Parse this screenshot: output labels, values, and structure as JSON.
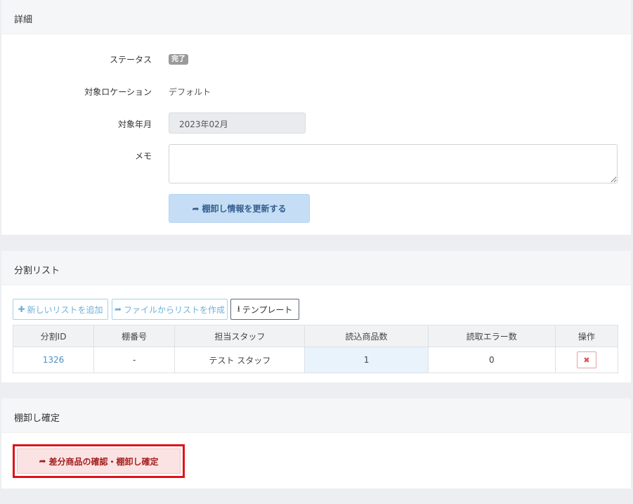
{
  "details": {
    "title": "詳細",
    "status_label": "ステータス",
    "status_value": "完了",
    "location_label": "対象ロケーション",
    "location_value": "デフォルト",
    "month_label": "対象年月",
    "month_value": "2023年02月",
    "memo_label": "メモ",
    "memo_value": "",
    "update_button": "棚卸し情報を更新する"
  },
  "split_list": {
    "title": "分割リスト",
    "add_button": "新しいリストを追加",
    "from_file_button": "ファイルからリストを作成",
    "template_button": "テンプレート",
    "columns": [
      "分割ID",
      "棚番号",
      "担当スタッフ",
      "読込商品数",
      "読取エラー数",
      "操作"
    ],
    "rows": [
      {
        "id": "1326",
        "shelf": "-",
        "staff": "テスト スタッフ",
        "read_count": "1",
        "error_count": "0"
      }
    ]
  },
  "confirm": {
    "title": "棚卸し確定",
    "button": "差分商品の確認・棚卸し確定"
  },
  "icons": {
    "share": "share-icon",
    "plus": "plus-icon",
    "download": "download-icon",
    "delete": "close-icon"
  },
  "colors": {
    "accent_blue": "#4a8fc9",
    "danger": "#d9534f",
    "highlight_border": "#e0121a"
  }
}
